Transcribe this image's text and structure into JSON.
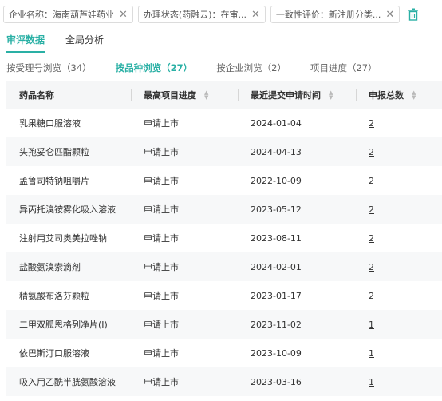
{
  "filters": [
    {
      "label": "企业名称：海南葫芦娃药业"
    },
    {
      "label": "办理状态(药融云)：在审..."
    },
    {
      "label": "一致性评价：新注册分类..."
    }
  ],
  "main_tabs": [
    {
      "label": "审评数据",
      "active": true
    },
    {
      "label": "全局分析",
      "active": false
    }
  ],
  "sub_tabs": [
    {
      "label": "按受理号浏览（34）",
      "active": false
    },
    {
      "label": "按品种浏览（27）",
      "active": true
    },
    {
      "label": "按企业浏览（2）",
      "active": false
    },
    {
      "label": "项目进度（27）",
      "active": false
    }
  ],
  "table": {
    "headers": [
      "药品名称",
      "最高项目进度",
      "最近提交申请时间",
      "申报总数"
    ],
    "rows": [
      {
        "name": "乳果糖口服溶液",
        "progress": "申请上市",
        "date": "2024-01-04",
        "count": "2"
      },
      {
        "name": "头孢妥仑匹酯颗粒",
        "progress": "申请上市",
        "date": "2024-04-13",
        "count": "2"
      },
      {
        "name": "孟鲁司特钠咀嚼片",
        "progress": "申请上市",
        "date": "2022-10-09",
        "count": "2"
      },
      {
        "name": "异丙托溴铵雾化吸入溶液",
        "progress": "申请上市",
        "date": "2023-05-12",
        "count": "2"
      },
      {
        "name": "注射用艾司奥美拉唑钠",
        "progress": "申请上市",
        "date": "2023-08-11",
        "count": "2"
      },
      {
        "name": "盐酸氨溴索滴剂",
        "progress": "申请上市",
        "date": "2024-02-01",
        "count": "2"
      },
      {
        "name": "精氨酸布洛芬颗粒",
        "progress": "申请上市",
        "date": "2023-01-17",
        "count": "2"
      },
      {
        "name": "二甲双胍恩格列净片(Ⅰ)",
        "progress": "申请上市",
        "date": "2023-11-02",
        "count": "1"
      },
      {
        "name": "依巴斯汀口服溶液",
        "progress": "申请上市",
        "date": "2023-10-09",
        "count": "1"
      },
      {
        "name": "吸入用乙酰半胱氨酸溶液",
        "progress": "申请上市",
        "date": "2023-03-16",
        "count": "1"
      }
    ]
  },
  "colors": {
    "accent": "#2ab0a5"
  }
}
